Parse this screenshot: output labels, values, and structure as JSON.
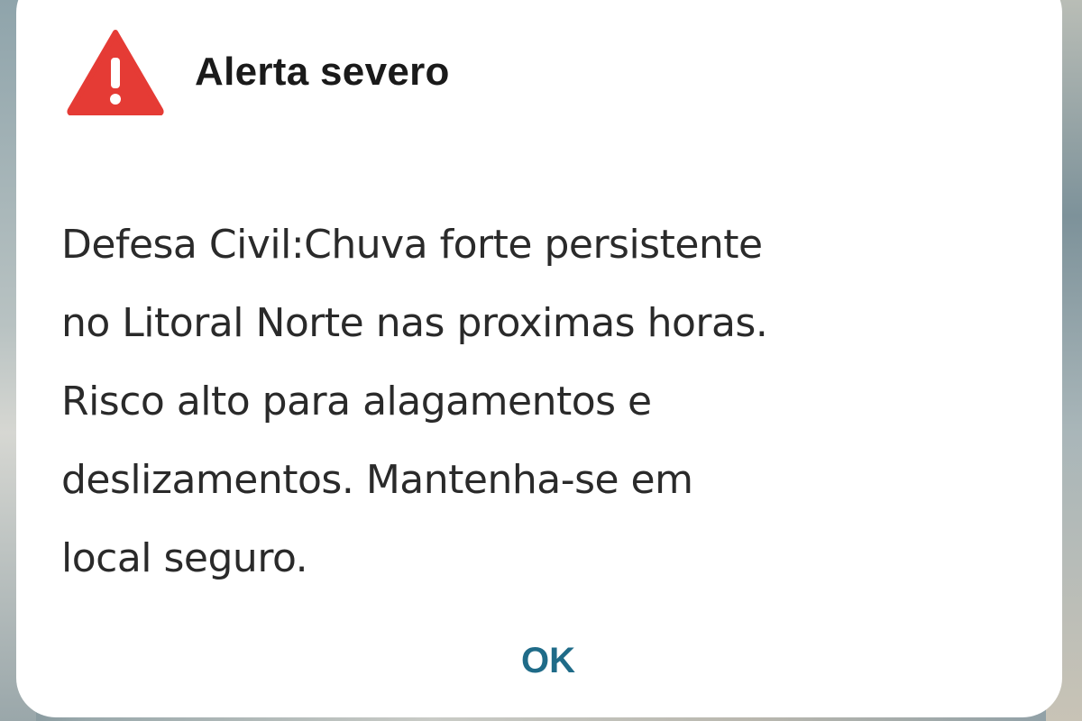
{
  "alert": {
    "icon": "warning-triangle-icon",
    "icon_color": "#e53b35",
    "title": "Alerta severo",
    "message": "Defesa Civil:Chuva forte persistente\nno Litoral Norte nas proximas horas.\nRisco alto para alagamentos e\ndeslizamentos. Mantenha-se em\nlocal seguro.",
    "ok_label": "OK",
    "ok_color": "#1f6b88"
  }
}
